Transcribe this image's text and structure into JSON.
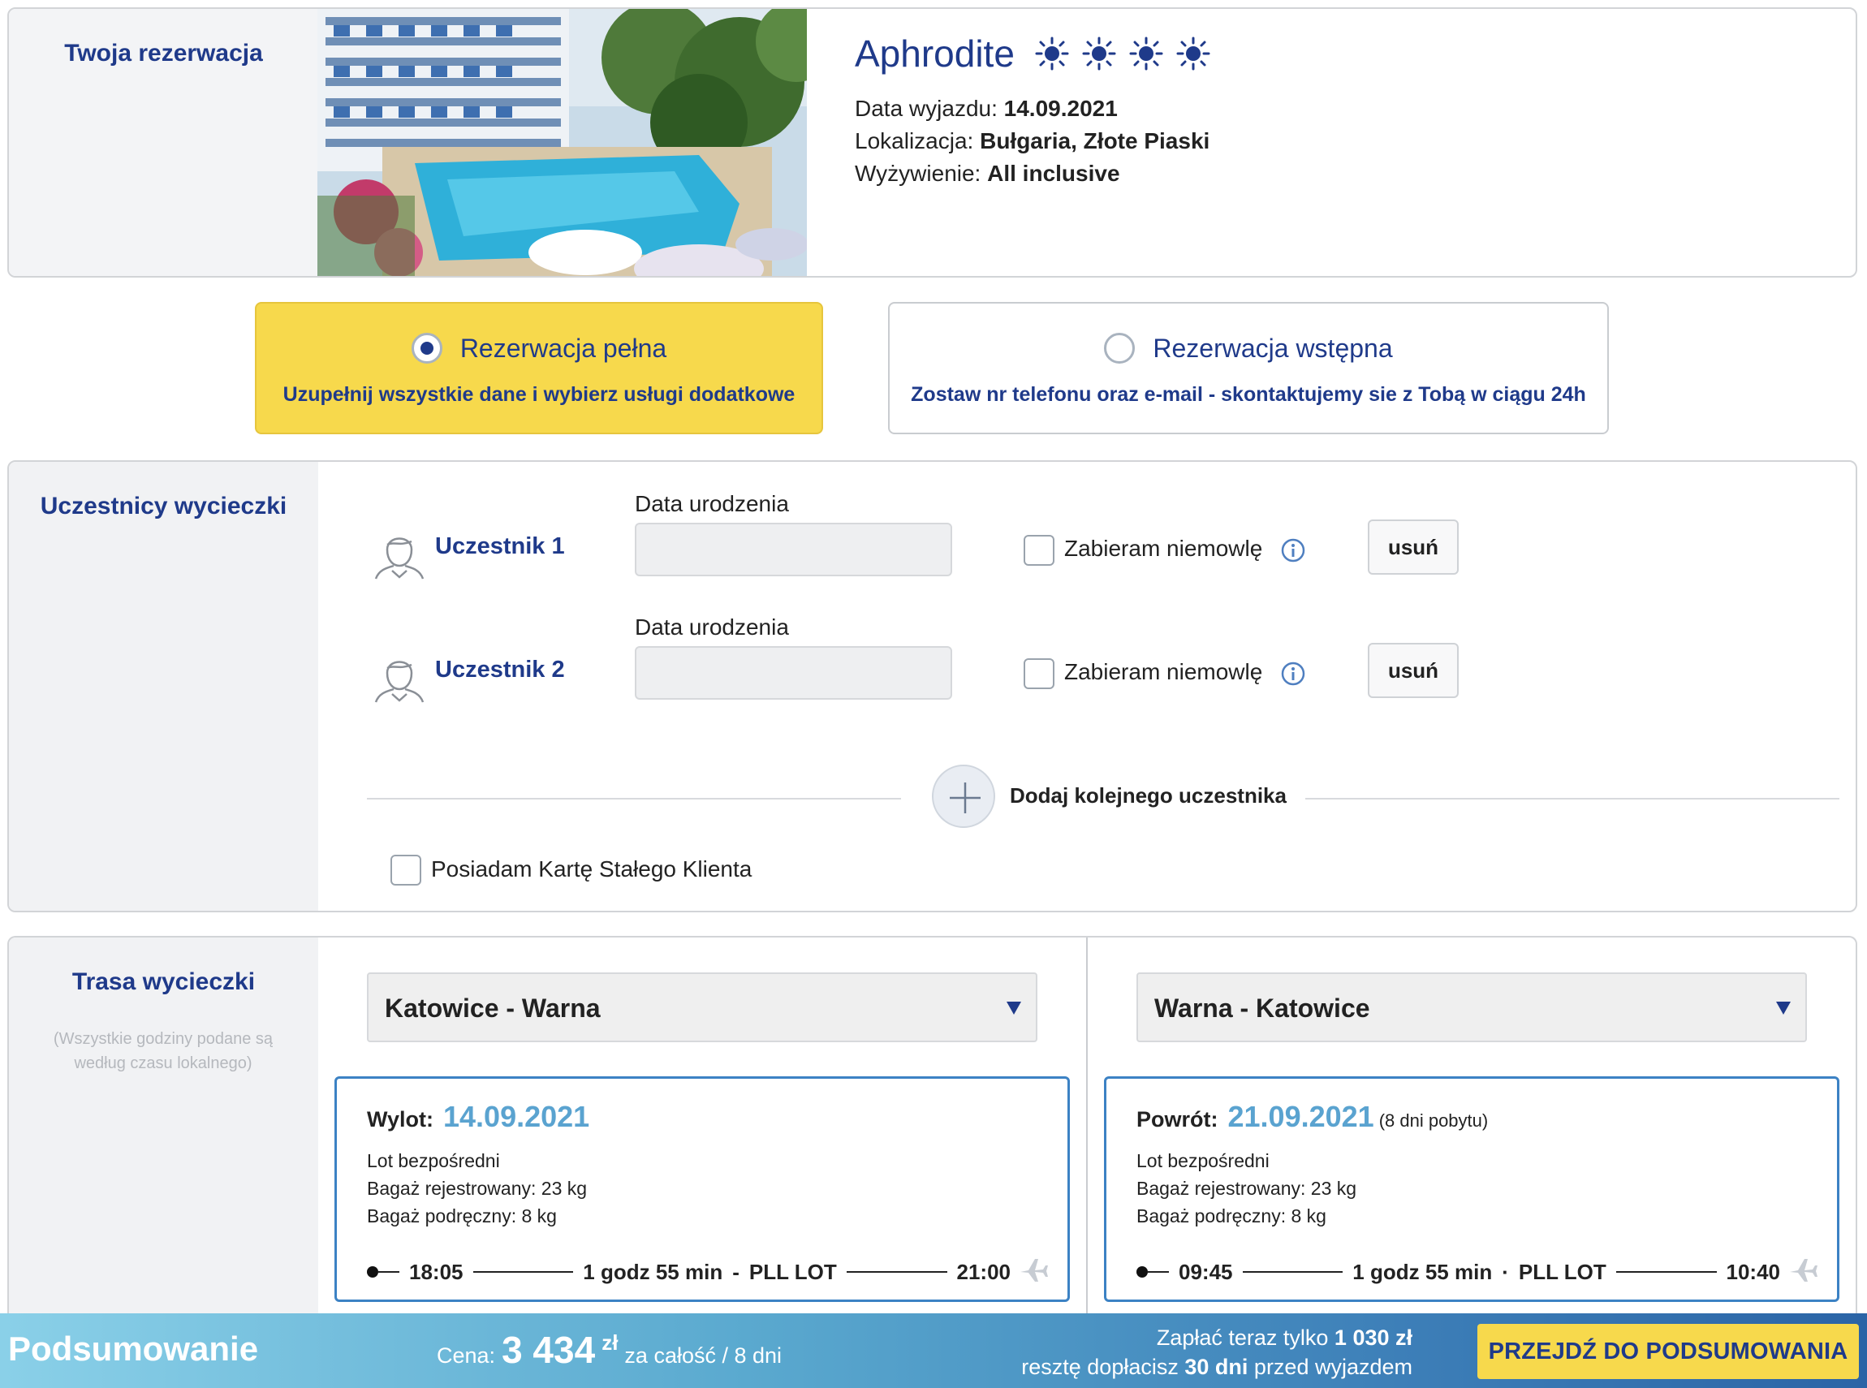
{
  "booking": {
    "section_title": "Twoja rezerwacja",
    "hotel_name": "Aphrodite",
    "stars": 4,
    "departure_label": "Data wyjazdu:",
    "departure_value": "14.09.2021",
    "location_label": "Lokalizacja:",
    "location_value": "Bułgaria, Złote Piaski",
    "board_label": "Wyżywienie:",
    "board_value": "All inclusive"
  },
  "reservation_type": {
    "full": {
      "title": "Rezerwacja pełna",
      "subtitle": "Uzupełnij wszystkie dane i wybierz usługi dodatkowe",
      "selected": true
    },
    "preliminary": {
      "title": "Rezerwacja wstępna",
      "subtitle": "Zostaw nr telefonu oraz e-mail - skontaktujemy sie z Tobą w ciągu 24h",
      "selected": false
    }
  },
  "participants": {
    "section_title": "Uczestnicy wycieczki",
    "items": [
      {
        "label": "Uczestnik 1",
        "dob_label": "Data urodzenia",
        "dob_value": "",
        "infant_label": "Zabieram niemowlę",
        "infant_checked": false,
        "remove_label": "usuń"
      },
      {
        "label": "Uczestnik 2",
        "dob_label": "Data urodzenia",
        "dob_value": "",
        "infant_label": "Zabieram niemowlę",
        "infant_checked": false,
        "remove_label": "usuń"
      }
    ],
    "add_label": "Dodaj kolejnego uczestnika",
    "loyalty_label": "Posiadam Kartę Stałego Klienta",
    "loyalty_checked": false
  },
  "route": {
    "section_title": "Trasa wycieczki",
    "note": "(Wszystkie godziny podane są według czasu lokalnego)",
    "outbound": {
      "select_value": "Katowice - Warna",
      "head_label": "Wylot:",
      "date": "14.09.2021",
      "stay": "",
      "line1": "Lot bezpośredni",
      "line2": "Bagaż rejestrowany: 23 kg",
      "line3": "Bagaż podręczny: 8 kg",
      "dep_time": "18:05",
      "duration": "1 godz 55 min",
      "sep": "-",
      "carrier": "PLL LOT",
      "arr_time": "21:00"
    },
    "inbound": {
      "select_value": "Warna - Katowice",
      "head_label": "Powrót:",
      "date": "21.09.2021",
      "stay": "(8 dni pobytu)",
      "line1": "Lot bezpośredni",
      "line2": "Bagaż rejestrowany: 23 kg",
      "line3": "Bagaż podręczny: 8 kg",
      "dep_time": "09:45",
      "duration": "1 godz 55 min",
      "sep": "·",
      "carrier": "PLL LOT",
      "arr_time": "10:40"
    }
  },
  "summary": {
    "title": "Podsumowanie",
    "price_label": "Cena:",
    "price_value": "3 434",
    "currency": "zł",
    "price_suffix": "za całość / 8 dni",
    "pay_now_prefix": "Zapłać teraz tylko",
    "pay_now_value": "1 030 zł",
    "rest_prefix": "resztę dopłacisz",
    "rest_value": "30 dni",
    "rest_suffix": "przed wyjazdem",
    "cta_label": "PRZEJDŹ DO PODSUMOWANIA"
  },
  "colors": {
    "brand_blue": "#1f3a8a",
    "accent_yellow": "#f7d94c",
    "date_blue": "#5aa3d0",
    "box_border": "#3c82c4"
  },
  "icons": [
    "sun-star-icon",
    "radio-icon",
    "avatar-icon",
    "calendar-icon",
    "info-icon",
    "plus-icon",
    "dropdown-arrow-icon",
    "plane-icon"
  ]
}
